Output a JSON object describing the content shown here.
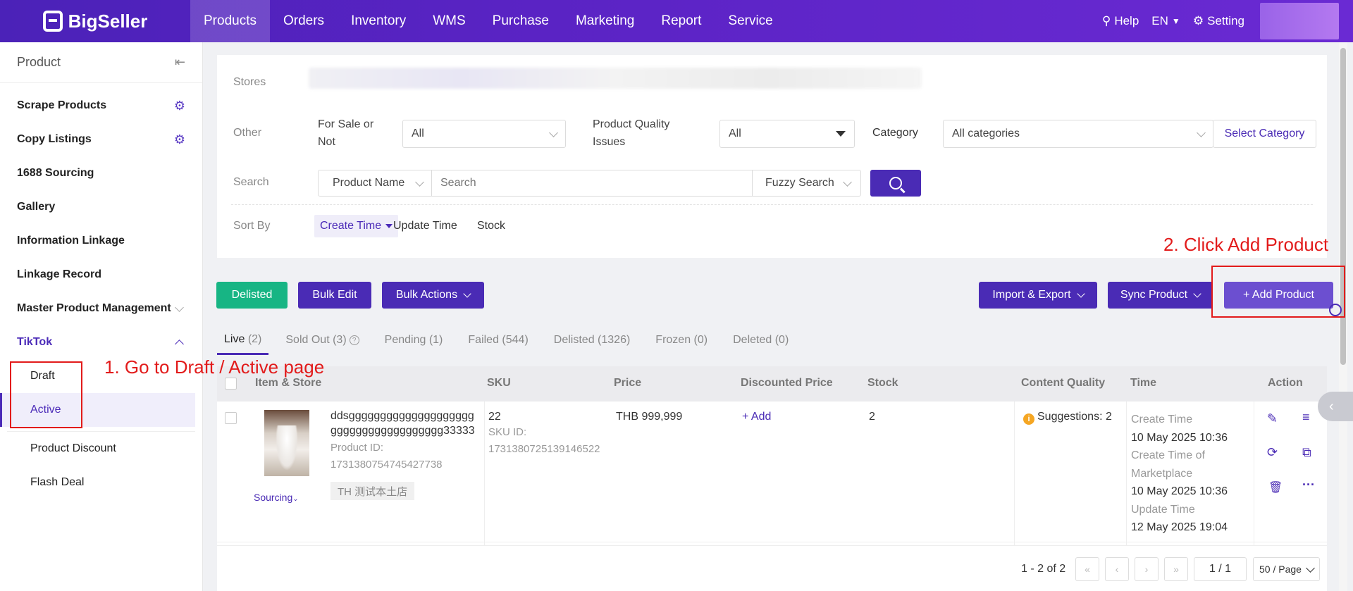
{
  "brand": "BigSeller",
  "nav": {
    "items": [
      "Products",
      "Orders",
      "Inventory",
      "WMS",
      "Purchase",
      "Marketing",
      "Report",
      "Service"
    ],
    "help": "Help",
    "lang": "EN",
    "settings": "Setting"
  },
  "sidebar": {
    "title": "Product",
    "items": [
      {
        "label": "Scrape Products"
      },
      {
        "label": "Copy Listings"
      },
      {
        "label": "1688 Sourcing"
      },
      {
        "label": "Gallery"
      },
      {
        "label": "Information Linkage"
      },
      {
        "label": "Linkage Record"
      },
      {
        "label": "Master Product Management"
      },
      {
        "label": "TikTok"
      }
    ],
    "tiktok_sub": [
      "Draft",
      "Active"
    ],
    "other_sub": [
      "Product Discount",
      "Flash Deal"
    ]
  },
  "filters": {
    "stores_label": "Stores",
    "other_label": "Other",
    "for_sale_label_1": "For Sale or",
    "for_sale_label_2": "Not",
    "for_sale_value": "All",
    "quality_label_1": "Product Quality",
    "quality_label_2": "Issues",
    "quality_value": "All",
    "category_label": "Category",
    "category_value": "All categories",
    "select_category": "Select Category",
    "search_label": "Search",
    "search_field": "Product Name",
    "search_placeholder": "Search",
    "search_mode": "Fuzzy Search",
    "sort_label": "Sort By",
    "sort_active": "Create Time",
    "sort_options": [
      "Update Time",
      "Stock"
    ]
  },
  "actions": {
    "delisted": "Delisted",
    "bulk_edit": "Bulk Edit",
    "bulk_actions": "Bulk Actions",
    "import_export": "Import & Export",
    "sync_product": "Sync Product",
    "add_product": "+ Add Product"
  },
  "tabs": [
    {
      "label": "Live",
      "count": "(2)"
    },
    {
      "label": "Sold Out",
      "count": "(3)"
    },
    {
      "label": "Pending",
      "count": "(1)"
    },
    {
      "label": "Failed",
      "count": "(544)"
    },
    {
      "label": "Delisted",
      "count": "(1326)"
    },
    {
      "label": "Frozen",
      "count": "(0)"
    },
    {
      "label": "Deleted",
      "count": "(0)"
    }
  ],
  "table": {
    "headers": [
      "Item & Store",
      "SKU",
      "Price",
      "Discounted Price",
      "Stock",
      "Content Quality",
      "Time",
      "Action"
    ],
    "row": {
      "name_line1": "ddsgggggggggggggggggggg",
      "name_line2": "gggggggggggggggggg33333",
      "product_id_label": "Product ID:",
      "product_id": "1731380754745427738",
      "store": "TH 测试本土店",
      "sourcing": "Sourcing",
      "sku": "22",
      "sku_id_label": "SKU ID:",
      "sku_id": "1731380725139146522",
      "price": "THB 999,999",
      "discount": "+ Add",
      "stock": "2",
      "quality": "Suggestions: 2",
      "create_time_label": "Create Time",
      "create_time": "10 May 2025 10:36",
      "create_mkt_label_1": "Create Time of",
      "create_mkt_label_2": "Marketplace",
      "create_mkt_time": "10 May 2025 10:36",
      "update_time_label": "Update Time",
      "update_time": "12 May 2025 19:04"
    }
  },
  "pager": {
    "summary": "1 - 2 of 2",
    "page": "1 / 1",
    "per_page": "50 / Page"
  },
  "annotations": {
    "step1": "1. Go to Draft / Active page",
    "step2": "2. Click Add Product"
  }
}
